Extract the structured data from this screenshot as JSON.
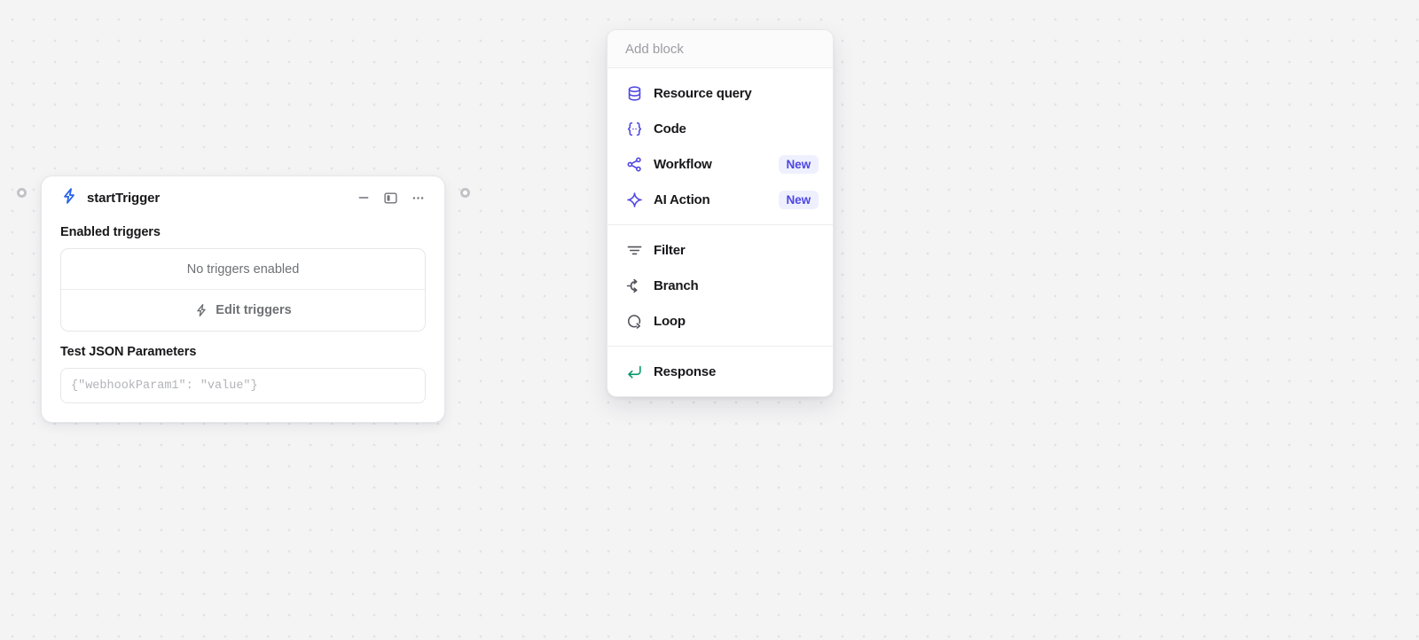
{
  "canvas": {
    "background_color": "#f4f4f5",
    "dot_color": "#e2e2e4"
  },
  "node": {
    "title": "startTrigger",
    "icon": "lightning-bolt-icon",
    "icon_color": "#2563eb",
    "header_actions": [
      {
        "name": "minimize",
        "icon": "minimize-icon"
      },
      {
        "name": "panel-toggle",
        "icon": "panel-left-icon"
      },
      {
        "name": "more-options",
        "icon": "ellipsis-icon"
      }
    ],
    "triggers_section": {
      "label": "Enabled triggers",
      "empty_text": "No triggers enabled",
      "edit_label": "Edit triggers",
      "edit_icon": "lightning-bolt-icon"
    },
    "json_section": {
      "label": "Test JSON Parameters",
      "value": "",
      "placeholder": "{\"webhookParam1\": \"value\"}"
    },
    "handles": {
      "left": "input-handle",
      "right": "output-handle"
    }
  },
  "add_block_menu": {
    "search_placeholder": "Add block",
    "search_value": "",
    "groups": [
      {
        "items": [
          {
            "label": "Resource query",
            "icon": "database-icon",
            "icon_color": "#4f46e5",
            "badge": ""
          },
          {
            "label": "Code",
            "icon": "code-braces-icon",
            "icon_color": "#4f46e5",
            "badge": ""
          },
          {
            "label": "Workflow",
            "icon": "share-nodes-icon",
            "icon_color": "#4f46e5",
            "badge": "New"
          },
          {
            "label": "AI Action",
            "icon": "sparkle-icon",
            "icon_color": "#4f46e5",
            "badge": "New"
          }
        ]
      },
      {
        "items": [
          {
            "label": "Filter",
            "icon": "filter-icon",
            "icon_color": "#52525b",
            "badge": ""
          },
          {
            "label": "Branch",
            "icon": "branch-icon",
            "icon_color": "#52525b",
            "badge": ""
          },
          {
            "label": "Loop",
            "icon": "loop-icon",
            "icon_color": "#52525b",
            "badge": ""
          }
        ]
      },
      {
        "items": [
          {
            "label": "Response",
            "icon": "return-arrow-icon",
            "icon_color": "#059669",
            "badge": ""
          }
        ]
      }
    ]
  }
}
